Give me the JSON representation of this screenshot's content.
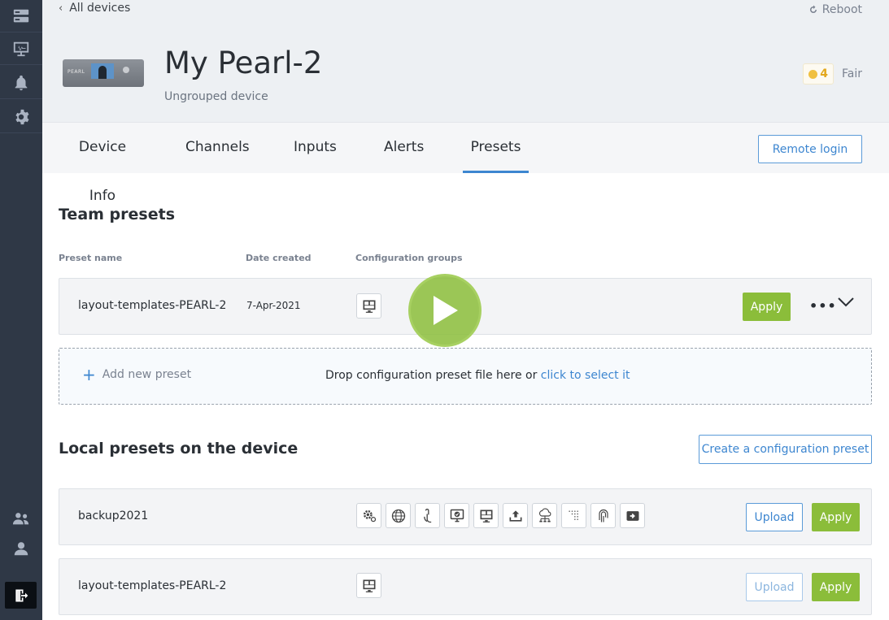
{
  "sidebar": {
    "items": [
      {
        "icon": "server-icon"
      },
      {
        "icon": "monitor-chart-icon"
      },
      {
        "icon": "bell-icon"
      },
      {
        "icon": "gear-icon"
      }
    ],
    "bottom_items": [
      {
        "icon": "team-icon"
      },
      {
        "icon": "user-icon"
      },
      {
        "icon": "logout-icon"
      }
    ]
  },
  "header": {
    "back_label": "All devices",
    "reboot_label": "Reboot",
    "device_name": "My Pearl-2",
    "device_group": "Ungrouped device",
    "device_brand": "PEARL",
    "health_count": "4",
    "health_label": "Fair"
  },
  "tabs": [
    {
      "label": "Device Info"
    },
    {
      "label": "Channels"
    },
    {
      "label": "Inputs"
    },
    {
      "label": "Alerts"
    },
    {
      "label": "Presets",
      "active": true
    }
  ],
  "remote_login_label": "Remote login",
  "team_presets": {
    "title": "Team presets",
    "columns": [
      "Preset name",
      "Date created",
      "Configuration groups"
    ],
    "rows": [
      {
        "name": "layout-templates-PEARL-2",
        "date": "7-Apr-2021",
        "groups": [
          "layout-icon"
        ],
        "apply_label": "Apply",
        "more_label": "•••"
      }
    ]
  },
  "dropzone": {
    "add_label": "Add new preset",
    "drop_text": "Drop configuration preset file here or ",
    "drop_link": "click to select it"
  },
  "local_presets": {
    "title": "Local presets on the device",
    "create_label": "Create a configuration preset",
    "rows": [
      {
        "name": "backup2021",
        "groups": [
          "system-gears-icon",
          "network-globe-icon",
          "touch-hand-icon",
          "display-check-icon",
          "layout-icon",
          "upload-icon",
          "cloud-network-icon",
          "dot-grid-icon",
          "fingerprint-icon",
          "streaming-icon"
        ],
        "upload_label": "Upload",
        "apply_label": "Apply"
      },
      {
        "name": "layout-templates-PEARL-2",
        "groups": [
          "layout-icon"
        ],
        "upload_label": "Upload",
        "upload_disabled": true,
        "apply_label": "Apply"
      }
    ]
  },
  "colors": {
    "sidebar_bg": "#2f3846",
    "accent_blue": "#3d86d0",
    "apply_green": "#8bbd3a",
    "health_yellow": "#e3a81d"
  }
}
